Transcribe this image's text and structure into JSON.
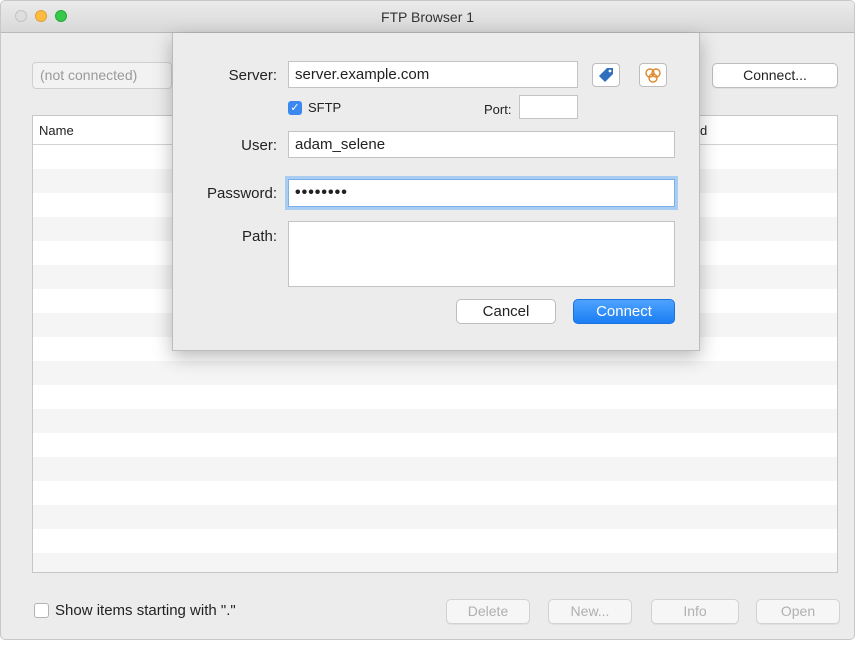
{
  "window": {
    "title": "FTP Browser 1"
  },
  "toolbar": {
    "status": "(not connected)",
    "connect_label": "Connect..."
  },
  "table": {
    "columns": [
      "Name",
      "d"
    ]
  },
  "footer": {
    "show_hidden_label": "Show items starting with \".\"",
    "delete_label": "Delete",
    "new_label": "New...",
    "info_label": "Info",
    "open_label": "Open"
  },
  "dialog": {
    "server_label": "Server:",
    "server_value": "server.example.com",
    "sftp_label": "SFTP",
    "sftp_checked": true,
    "port_label": "Port:",
    "port_value": "",
    "user_label": "User:",
    "user_value": "adam_selene",
    "password_label": "Password:",
    "password_mask": "••••••••",
    "path_label": "Path:",
    "path_value": "",
    "cancel_label": "Cancel",
    "connect_label": "Connect"
  },
  "icons": {
    "bookmark": "bookmark-tag-icon",
    "recent": "recent-servers-icon"
  },
  "colors": {
    "accent": "#1b7ef3",
    "checkbox_on": "#3b89ee",
    "focus_ring": "#a9ccf3"
  }
}
